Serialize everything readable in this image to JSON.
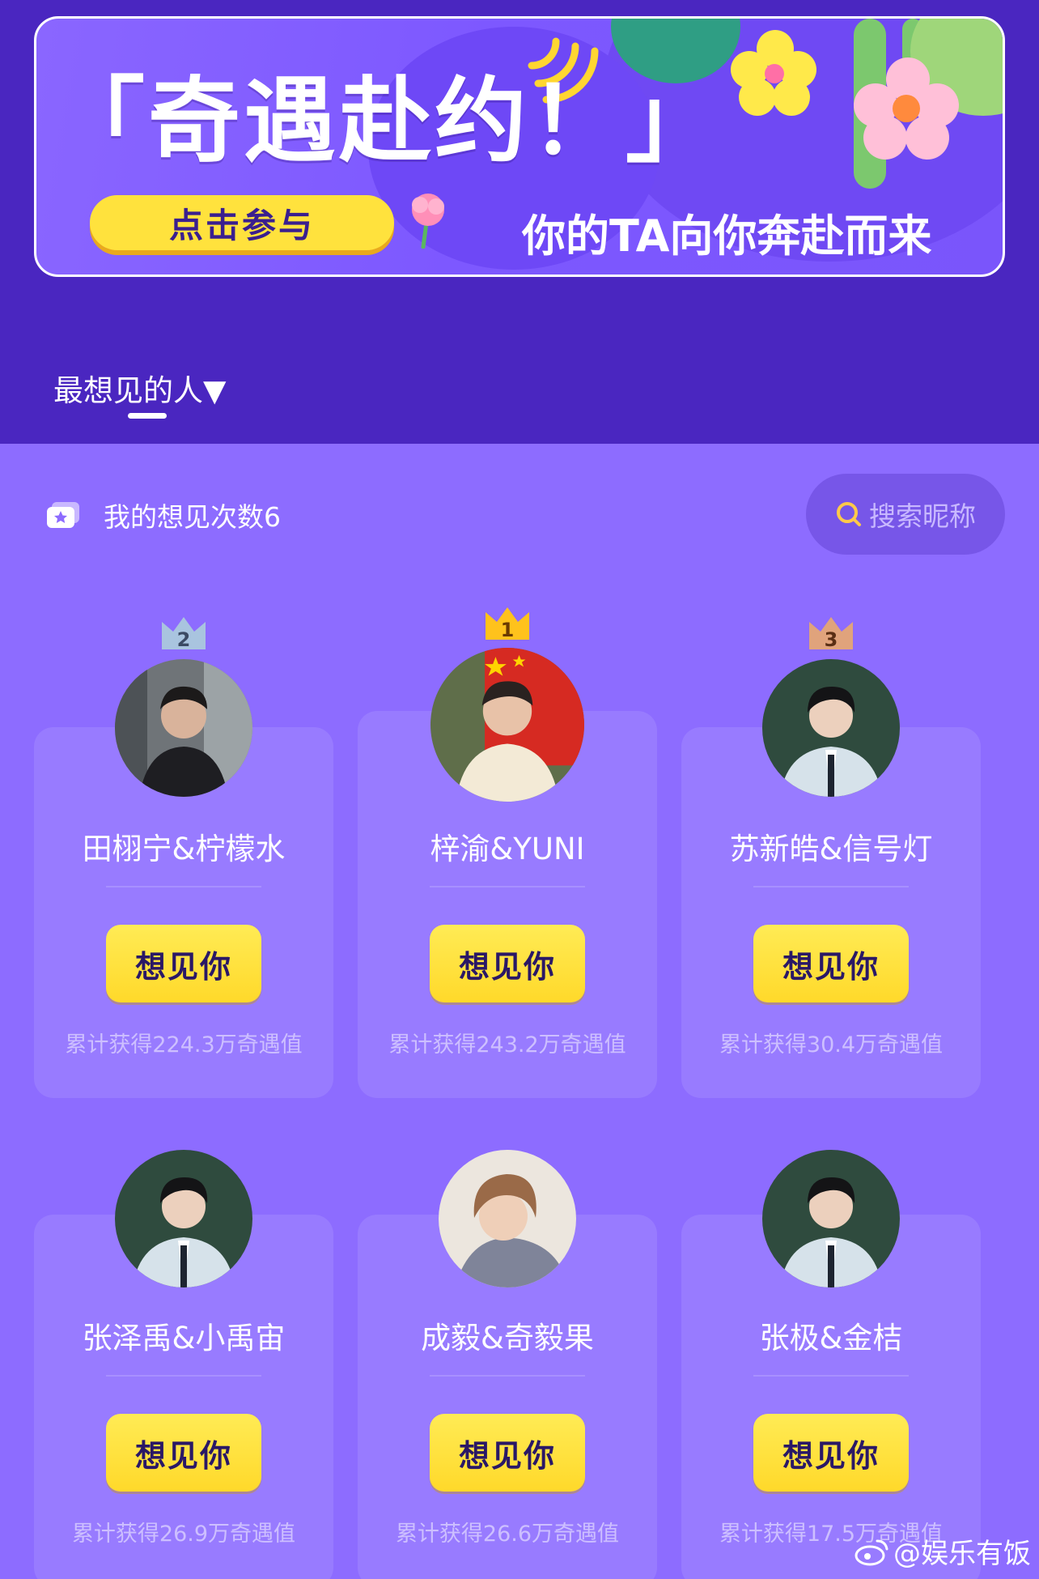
{
  "banner": {
    "title": "「奇遇赴约！」",
    "join_label": "点击参与",
    "slogan": "你的TA向你奔赴而来"
  },
  "tab": {
    "label": "最想见的人▼"
  },
  "my_count": {
    "text": "我的想见次数6"
  },
  "search": {
    "placeholder": "搜索昵称"
  },
  "candidates": [
    {
      "name": "田栩宁&柠檬水",
      "rank": "2",
      "button": "想见你",
      "total": "累计获得224.3万奇遇值"
    },
    {
      "name": "梓渝&YUNI",
      "rank": "1",
      "button": "想见你",
      "total": "累计获得243.2万奇遇值"
    },
    {
      "name": "苏新皓&信号灯",
      "rank": "3",
      "button": "想见你",
      "total": "累计获得30.4万奇遇值"
    },
    {
      "name": "张泽禹&小禹宙",
      "button": "想见你",
      "total": "累计获得26.9万奇遇值"
    },
    {
      "name": "成毅&奇毅果",
      "button": "想见你",
      "total": "累计获得26.6万奇遇值"
    },
    {
      "name": "张极&金桔",
      "button": "想见你",
      "total": "累计获得17.5万奇遇值"
    }
  ],
  "watermark": {
    "text": "@娱乐有饭"
  },
  "colors": {
    "header_bg": "#4a26c0",
    "content_bg": "#8d6cff",
    "button_yellow": "#ffe23d",
    "crown_gold": "#ffc21c",
    "crown_silver": "#a9c4df",
    "crown_bronze": "#e0a37c"
  }
}
